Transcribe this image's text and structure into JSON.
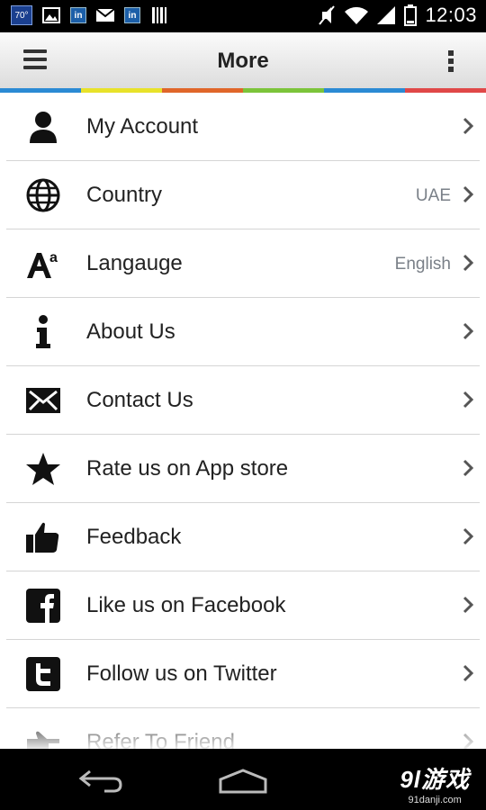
{
  "status_bar": {
    "time": "12:03",
    "temp_badge": "70°",
    "in_badge": "in",
    "battery": "2"
  },
  "action_bar": {
    "title": "More"
  },
  "strip_colors": [
    "#2b8ad4",
    "#e8e22a",
    "#e0662a",
    "#7cc43a",
    "#2b8ad4",
    "#e04848"
  ],
  "menu_items": [
    {
      "label": "My Account",
      "value": "",
      "icon": "person-icon"
    },
    {
      "label": "Country",
      "value": "UAE",
      "icon": "globe-icon"
    },
    {
      "label": "Langauge",
      "value": "English",
      "icon": "font-size-icon"
    },
    {
      "label": "About Us",
      "value": "",
      "icon": "info-icon"
    },
    {
      "label": "Contact Us",
      "value": "",
      "icon": "envelope-icon"
    },
    {
      "label": "Rate us on App store",
      "value": "",
      "icon": "star-icon"
    },
    {
      "label": "Feedback",
      "value": "",
      "icon": "thumbs-up-icon"
    },
    {
      "label": "Like us on Facebook",
      "value": "",
      "icon": "facebook-icon"
    },
    {
      "label": "Follow us on Twitter",
      "value": "",
      "icon": "twitter-icon"
    },
    {
      "label": "Refer To Friend",
      "value": "",
      "icon": "pointing-hand-icon"
    }
  ],
  "watermark": {
    "logo": "9l游戏",
    "url": "91danji.com"
  }
}
